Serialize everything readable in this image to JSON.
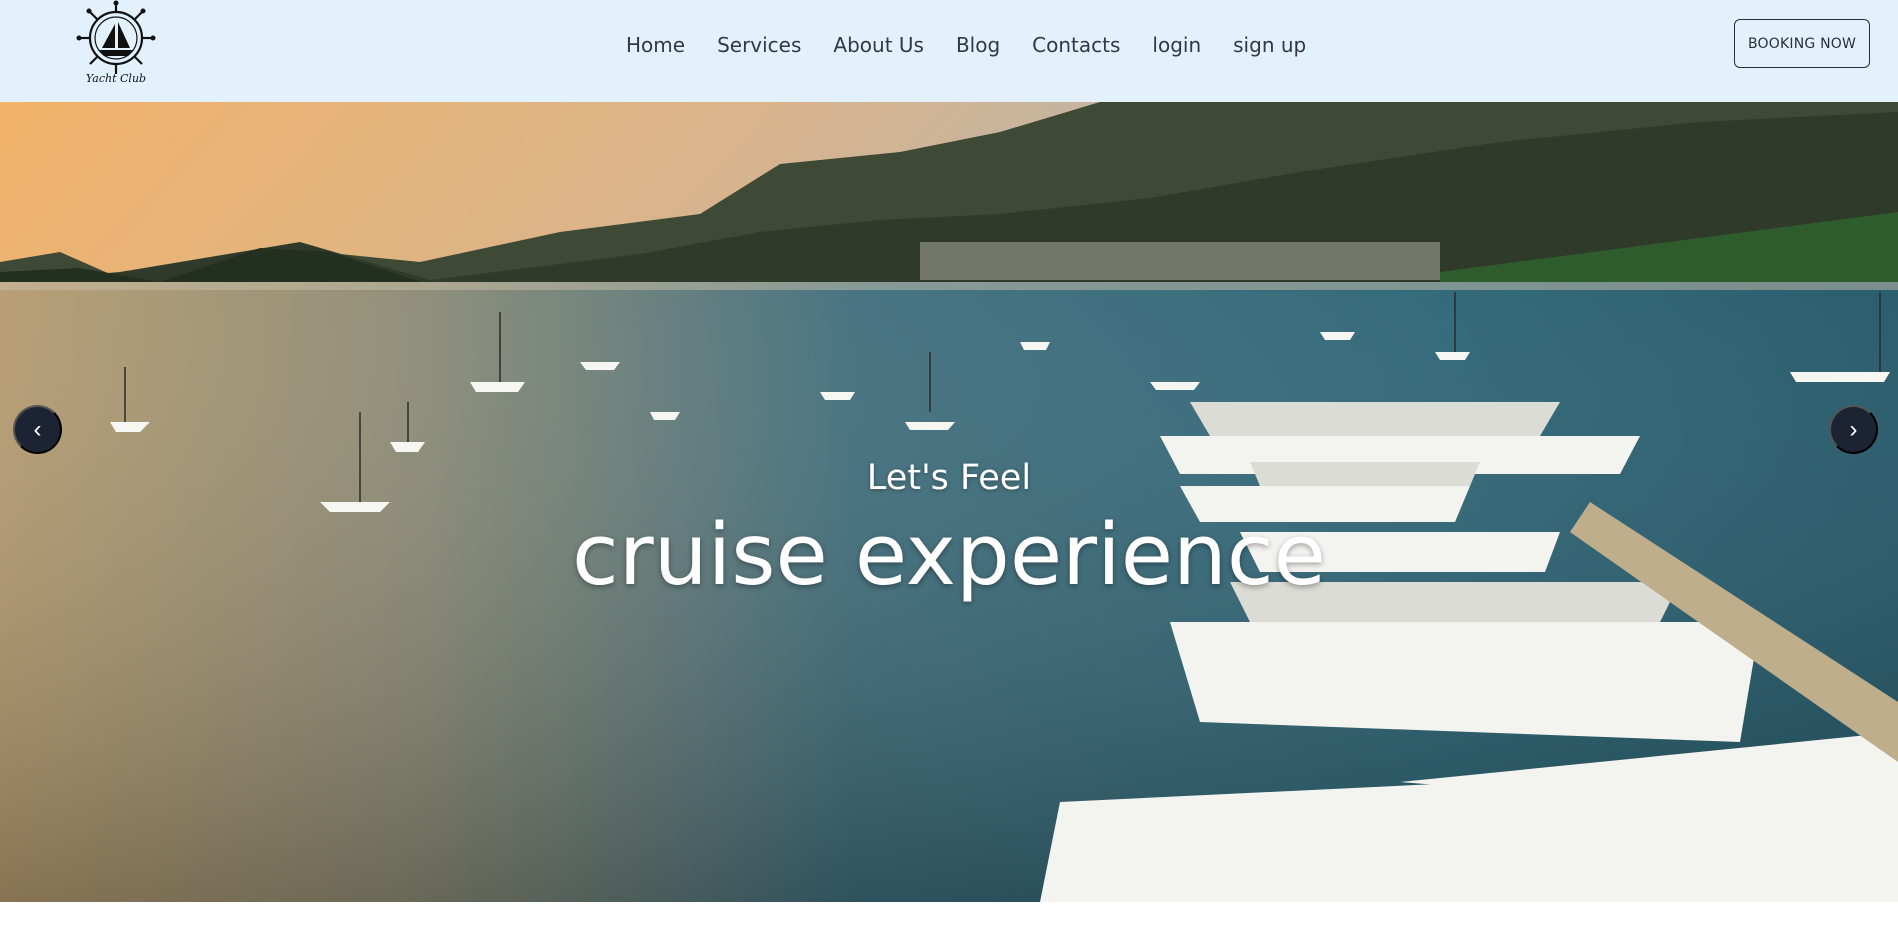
{
  "brand": {
    "logo_text": "Yacht Club"
  },
  "nav": {
    "items": [
      {
        "label": "Home"
      },
      {
        "label": "Services"
      },
      {
        "label": "About Us"
      },
      {
        "label": "Blog"
      },
      {
        "label": "Contacts"
      },
      {
        "label": "login"
      },
      {
        "label": "sign up"
      }
    ],
    "booking_label": "BOOKING NOW"
  },
  "hero": {
    "subtitle": "Let's Feel",
    "title": "cruise experience",
    "prev_icon": "chevron-left-icon",
    "next_icon": "chevron-right-icon",
    "prev_glyph": "‹",
    "next_glyph": "›"
  },
  "colors": {
    "navbar_bg": "#e3f1fd",
    "nav_text": "#333842",
    "arrow_bg": "#1c2433",
    "hero_text": "#ffffff"
  }
}
